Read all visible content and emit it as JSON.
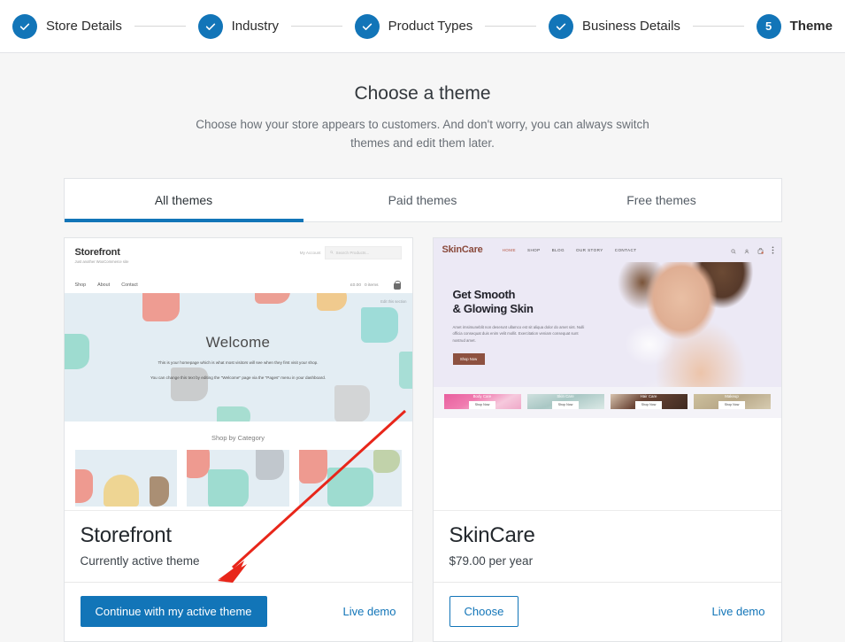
{
  "stepper": {
    "steps": [
      {
        "label": "Store Details",
        "state": "complete",
        "badge": "check-icon"
      },
      {
        "label": "Industry",
        "state": "complete",
        "badge": "check-icon"
      },
      {
        "label": "Product Types",
        "state": "complete",
        "badge": "check-icon"
      },
      {
        "label": "Business Details",
        "state": "complete",
        "badge": "check-icon"
      },
      {
        "label": "Theme",
        "state": "current",
        "badge": "5"
      }
    ]
  },
  "page": {
    "title": "Choose a theme",
    "subtitle": "Choose how your store appears to customers. And don't worry, you can always switch themes and edit them later."
  },
  "tabs": [
    {
      "label": "All themes",
      "active": true
    },
    {
      "label": "Paid themes",
      "active": false
    },
    {
      "label": "Free themes",
      "active": false
    }
  ],
  "themes": [
    {
      "name": "Storefront",
      "meta": "Currently active theme",
      "primary_action": "Continue with my active theme",
      "demo_link": "Live demo",
      "preview": {
        "brand": "Storefront",
        "tagline": "Just another WooCommerce site",
        "nav": [
          "Shop",
          "About",
          "Contact"
        ],
        "account": "My Account",
        "search_placeholder": "Search Products...",
        "cart_price": "£0.00",
        "cart_label": "0 items",
        "edit_hint": "Edit this section",
        "hero_title": "Welcome",
        "hero_line1": "This is your homepage which is what most visitors will see when they first visit your shop.",
        "hero_line2": "You can change this text by editing the \"Welcome\" page via the \"Pages\" menu in your dashboard.",
        "categories_title": "Shop by Category"
      }
    },
    {
      "name": "SkinCare",
      "meta": "$79.00 per year",
      "primary_action": "Choose",
      "demo_link": "Live demo",
      "preview": {
        "brand": "SkinCare",
        "nav": [
          "HOME",
          "SHOP",
          "BLOG",
          "OUR STORY",
          "CONTACT"
        ],
        "hero_title_line1": "Get Smooth",
        "hero_title_line2": "& Glowing Skin",
        "hero_body": "Amet irnsimuneblit non deserunt ullamco est sit aliqua dolor do amet sint. Nulli officia consequat duis enim velit mollit. Exercitation veniam consequat sunt nostrud amet.",
        "hero_button": "Shop Now",
        "tiles": [
          {
            "label": "Body Care",
            "button": "Shop Now"
          },
          {
            "label": "Skin Care",
            "button": "Shop Now"
          },
          {
            "label": "Hair Care",
            "button": "Shop Now"
          },
          {
            "label": "Makeup",
            "button": "Shop Now"
          }
        ]
      }
    }
  ],
  "colors": {
    "accent": "#1275b8",
    "annotation": "#e8261a",
    "page_background": "#f6f6f6",
    "storefront_hero": "#e3edf3",
    "skincare_hero": "#ece9f5"
  }
}
